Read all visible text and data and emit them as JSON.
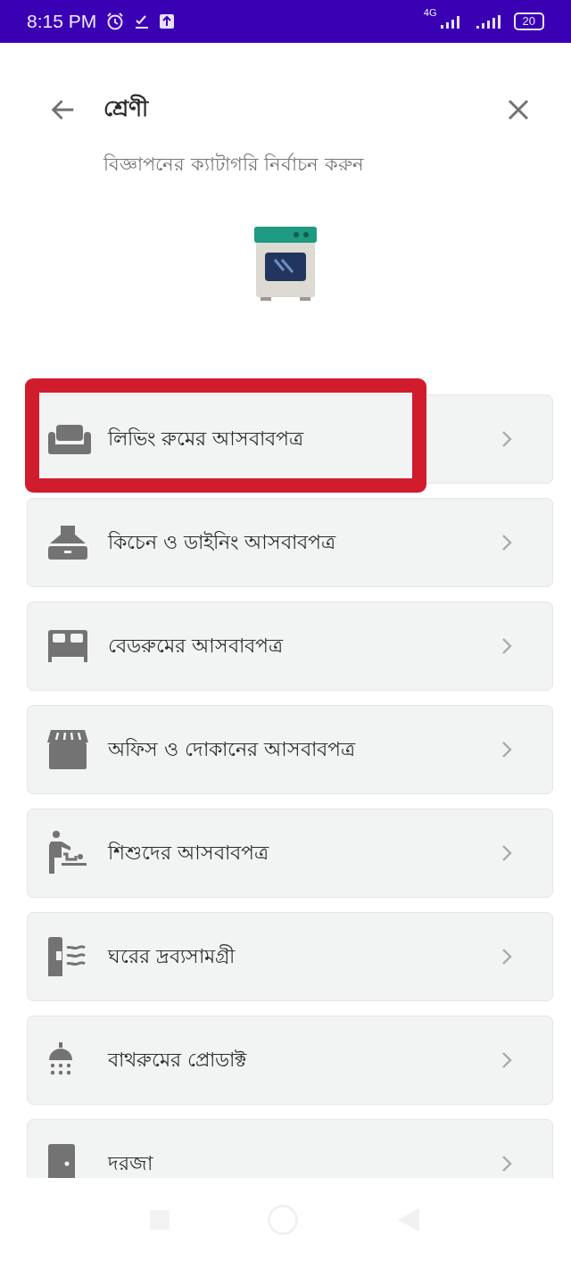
{
  "status_bar": {
    "time": "8:15 PM",
    "network": "4G",
    "battery": "20"
  },
  "header": {
    "title": "শ্রেণী",
    "subtitle": "বিজ্ঞাপনের ক্যাটাগরি নির্বাচন করুন"
  },
  "categories": [
    {
      "label": "লিভিং রুমের আসবাবপত্র",
      "kind": "sofa",
      "highlighted": true
    },
    {
      "label": "কিচেন ও ডাইনিং আসবাবপত্র",
      "kind": "hood",
      "highlighted": false
    },
    {
      "label": "বেডরুমের আসবাবপত্র",
      "kind": "bed",
      "highlighted": false
    },
    {
      "label": "অফিস ও দোকানের আসবাবপত্র",
      "kind": "store",
      "highlighted": false
    },
    {
      "label": "শিশুদের আসবাবপত্র",
      "kind": "baby",
      "highlighted": false
    },
    {
      "label": "ঘরের দ্রব্যসামগ্রী",
      "kind": "heater",
      "highlighted": false
    },
    {
      "label": "বাথরুমের প্রোডাক্ট",
      "kind": "shower",
      "highlighted": false
    },
    {
      "label": "দরজা",
      "kind": "door",
      "highlighted": false
    }
  ]
}
